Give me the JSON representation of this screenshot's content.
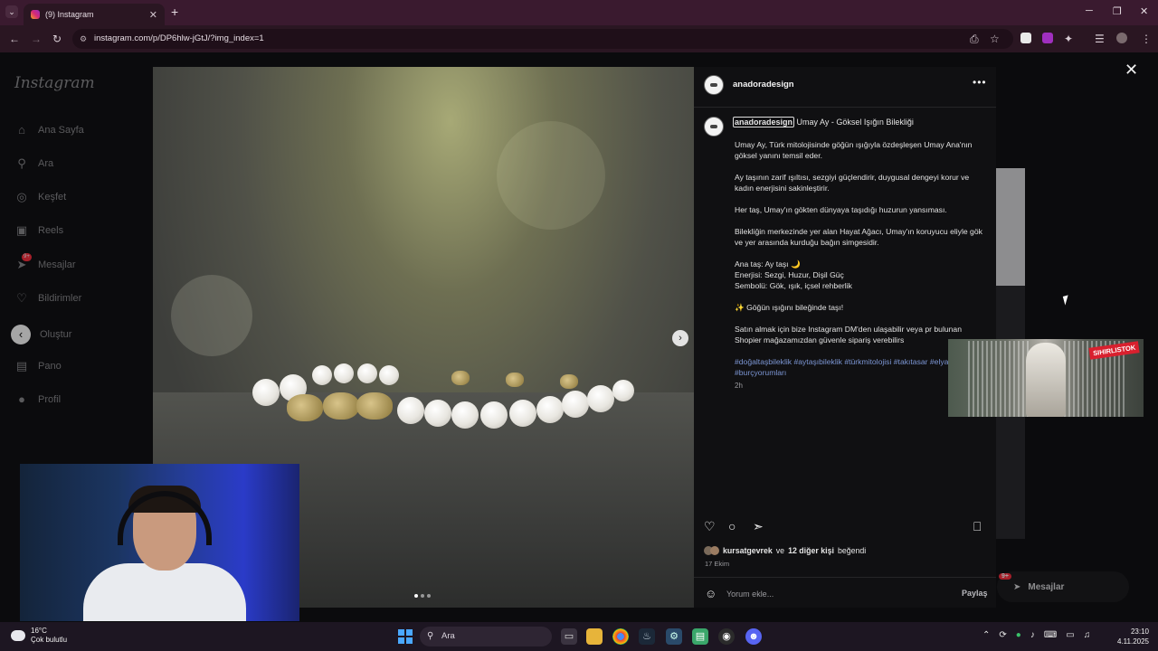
{
  "browser": {
    "tab_title": "(9) Instagram",
    "tab_close": "✕",
    "new_tab": "+",
    "url": "instagram.com/p/DP6hlw-jGtJ/?img_index=1"
  },
  "sidebar": {
    "logo": "Instagram",
    "items": [
      {
        "label": "Ana Sayfa",
        "icon": "⌂"
      },
      {
        "label": "Ara",
        "icon": "⚲"
      },
      {
        "label": "Keşfet",
        "icon": "◎"
      },
      {
        "label": "Reels",
        "icon": "▣"
      },
      {
        "label": "Mesajlar",
        "icon": "➤",
        "badge": "9+"
      },
      {
        "label": "Bildirimler",
        "icon": "♡"
      },
      {
        "label": "Oluştur",
        "icon": "‹"
      },
      {
        "label": "Pano",
        "icon": "▤"
      },
      {
        "label": "Profil",
        "icon": "●"
      }
    ]
  },
  "post": {
    "username": "anadoradesign",
    "more": "•••",
    "caption_title": "Umay Ay - Göksel Işığın Bilekliği",
    "caption_paragraphs": [
      "Umay Ay, Türk mitolojisinde göğün ışığıyla özdeşleşen Umay Ana'nın göksel yanını temsil eder.",
      "Ay taşının zarif ışıltısı, sezgiyi güçlendirir, duygusal dengeyi korur ve kadın enerjisini sakinleştirir.",
      "Her taş, Umay'ın gökten dünyaya taşıdığı huzurun yansıması.",
      "Bilekliğin merkezinde yer alan Hayat Ağacı, Umay'ın koruyucu eliyle gök ve yer arasında kurduğu bağın simgesidir."
    ],
    "details": {
      "line1": "Ana taş: Ay taşı 🌙",
      "line2": "Enerjisi: Sezgi, Huzur, Dişil Güç",
      "line3": "Sembolü: Gök, ışık, içsel rehberlik"
    },
    "cta": "✨ Göğün ışığını bileğinde taşı!",
    "purchase_text": "Satın almak için bize Instagram DM'den ulaşabilir veya pr bulunan Shopier mağazamızdan güvenle sipariş verebilirs",
    "hashtags": "#doğaltaşbileklik #aytaşıbileklik #türkmitolojisi #takıtasar #elyapımıtakı #burçyorumları",
    "caption_time": "2h",
    "likes_user": "kursatgevrek",
    "likes_mid": " ve ",
    "likes_count": "12 diğer kişi",
    "likes_suffix": " beğendi",
    "date": "17 Ekim",
    "comment_placeholder": "Yorum ekle...",
    "share_label": "Paylaş"
  },
  "background": {
    "messages_label": "Mesajlar",
    "messages_badge": "9+"
  },
  "ad_badge": "SIHIRLISTOK",
  "taskbar": {
    "weather_temp": "16°C",
    "weather_desc": "Çok bulutlu",
    "search_label": "Ara",
    "time": "23:10",
    "date": "4.11.2025"
  },
  "colors": {
    "accent_link": "#7c96d4",
    "notification_red": "#ff3040",
    "tab_bar": "#3a1a2f"
  }
}
